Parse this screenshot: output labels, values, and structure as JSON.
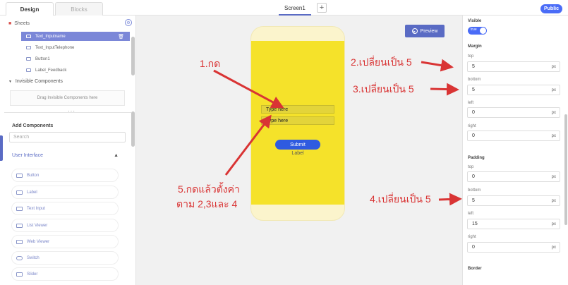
{
  "tabs": {
    "design": "Design",
    "blocks": "Blocks"
  },
  "screen_tab": "Screen1",
  "add_screen": "+",
  "public_label": "Public",
  "sheets": {
    "label": "Sheets",
    "items": [
      "Text_Inputname",
      "Text_InputTelephone",
      "Button1",
      "Label_Feedback"
    ]
  },
  "invisible": {
    "title": "Invisible Components",
    "drop_hint": "Drag Invisible Components here"
  },
  "add_components": {
    "title": "Add Components",
    "search_placeholder": "Search",
    "section": "User Interface",
    "items": [
      "Button",
      "Label",
      "Text Input",
      "List Viewer",
      "Web Viewer",
      "Switch",
      "Slider"
    ]
  },
  "canvas": {
    "preview_label": "Preview",
    "textbox1": "Type here",
    "textbox2": "Type here",
    "submit_label": "Submit",
    "label_text": "Label"
  },
  "annotations": {
    "a1": "1.กด",
    "a2": "2.เปลี่ยนเป็น 5",
    "a3": "3.เปลี่ยนเป็น 5",
    "a4": "4.เปลี่ยนเป็น 5",
    "a5_line1": "5.กดแล้วตั้งค่า",
    "a5_line2": "ตาม 2,3และ 4"
  },
  "props": {
    "visible_label": "Visible",
    "visible_value": "true",
    "margin_label": "Margin",
    "padding_label": "Padding",
    "border_label": "Border",
    "unit": "px",
    "top_label": "top",
    "bottom_label": "bottom",
    "left_label": "left",
    "right_label": "right",
    "margin": {
      "top": "5",
      "bottom": "5",
      "left": "0",
      "right": "0"
    },
    "padding": {
      "top": "0",
      "bottom": "5",
      "left": "15",
      "right": "0"
    }
  },
  "colors": {
    "accent": "#5a6bc4",
    "primary": "#4a6cf7",
    "annotation": "#d93434",
    "screen": "#f5e22a"
  }
}
